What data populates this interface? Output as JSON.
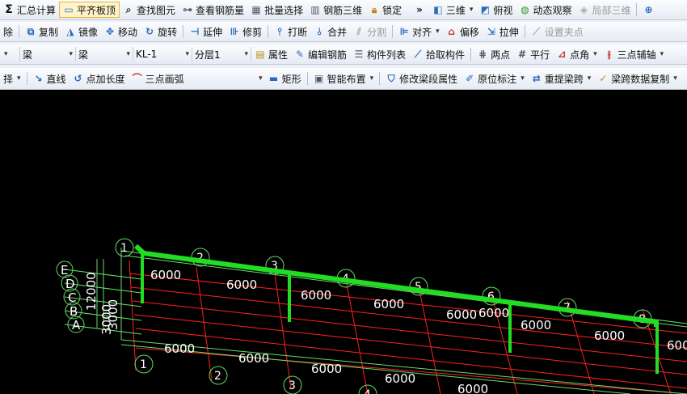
{
  "toolbar1": {
    "sigma_glyph": "Σ",
    "summary_calc": "汇总计算",
    "flat_slab_top": "平齐板顶",
    "find_element": "查找图元",
    "view_rebar": "查看钢筋量",
    "batch_select": "批量选择",
    "rebar_3d": "钢筋三维",
    "lock": "锁定",
    "overflow": "»",
    "view_3d": "三维",
    "top_view": "俯视",
    "dynamic_observe": "动态观察",
    "partial_3d": "局部三维"
  },
  "toolbar2": {
    "delete": "除",
    "copy": "复制",
    "mirror": "镜像",
    "move": "移动",
    "rotate": "旋转",
    "extend": "延伸",
    "trim": "修剪",
    "break": "打断",
    "merge": "合并",
    "split": "分割",
    "align": "对齐",
    "offset": "偏移",
    "stretch": "拉伸",
    "set_grip": "设置夹点"
  },
  "toolbar3": {
    "category": "梁",
    "type": "梁",
    "member": "KL-1",
    "layer": "分层1",
    "properties": "属性",
    "edit_rebar": "编辑钢筋",
    "member_list": "构件列表",
    "pick_member": "拾取构件",
    "two_points": "两点",
    "parallel": "平行",
    "point_angle": "点角",
    "three_point_aux": "三点辅轴"
  },
  "toolbar4": {
    "select_tail": "择",
    "line": "直线",
    "point_extend": "点加长度",
    "three_point_arc": "三点画弧",
    "rectangle": "矩形",
    "smart_layout": "智能布置",
    "edit_beam_props": "修改梁段属性",
    "origin_annotation": "原位标注",
    "reextract_span": "重提梁跨",
    "copy_span_data": "梁跨数据复制"
  },
  "canvas": {
    "bg_color": "#000000",
    "grid_red": "#ff2020",
    "grid_green": "#66dd66",
    "beam_color": "#22dd22",
    "axis_numbers_back": [
      "1",
      "2",
      "3",
      "4",
      "5",
      "6",
      "7",
      "8"
    ],
    "axis_numbers_front": [
      "1",
      "2",
      "3",
      "4"
    ],
    "axis_letters": [
      "E",
      "D",
      "C",
      "B",
      "A"
    ],
    "spacing_back": [
      "6000",
      "6000",
      "6000",
      "6000",
      "6000",
      "6000",
      "6000"
    ],
    "spacing_front": [
      "6000",
      "6000",
      "6000",
      "6000",
      "6000"
    ],
    "spacing_6000_extra": "6000",
    "spacing_vertical": [
      "12000",
      "3000",
      "3000"
    ],
    "beam_name": "KL-1"
  }
}
